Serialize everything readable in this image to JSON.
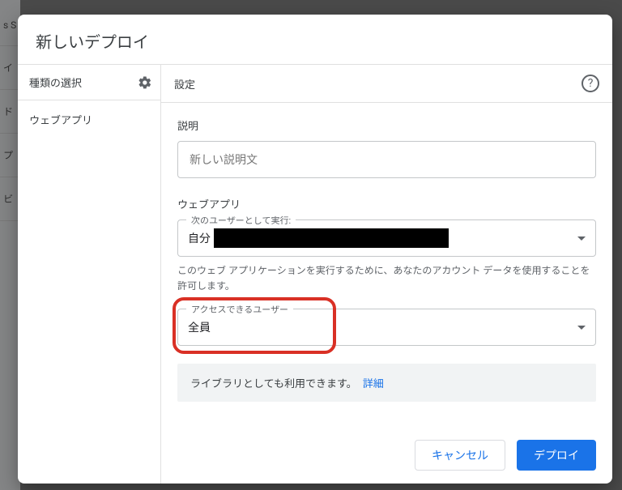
{
  "dialog": {
    "title": "新しいデプロイ"
  },
  "sidebar": {
    "header": "種類の選択",
    "items": [
      {
        "label": "ウェブアプリ"
      }
    ]
  },
  "main": {
    "header": "設定",
    "description": {
      "label": "説明",
      "placeholder": "新しい説明文"
    },
    "webapp": {
      "label": "ウェブアプリ",
      "runAs": {
        "legend": "次のユーザーとして実行:",
        "value": "自分"
      },
      "permissionHint": "このウェブ アプリケーションを実行するために、あなたのアカウント データを使用することを許可します。",
      "access": {
        "legend": "アクセスできるユーザー",
        "value": "全員"
      }
    },
    "banner": {
      "text": "ライブラリとしても利用できます。",
      "link": "詳細"
    }
  },
  "footer": {
    "cancel": "キャンセル",
    "deploy": "デプロイ"
  }
}
